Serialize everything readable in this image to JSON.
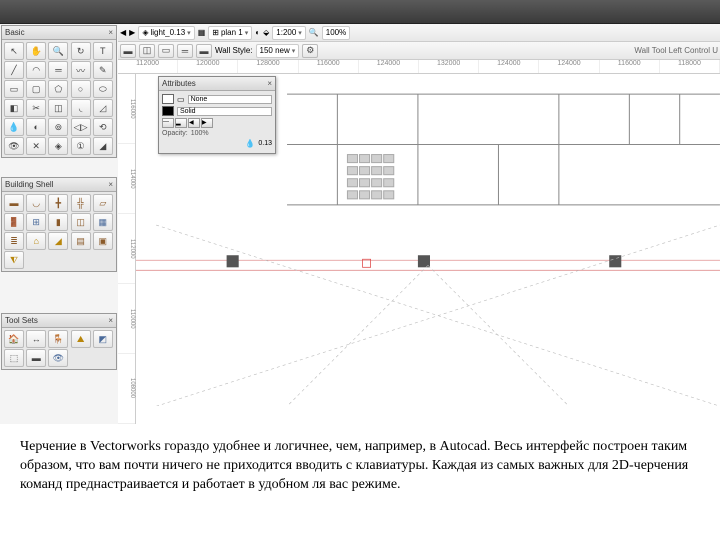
{
  "top": {
    "doc_dropdown": "light_0.13",
    "view_dropdown": "plan 1",
    "scale": "1:200",
    "zoom": "100%",
    "wall_style_label": "Wall Style:",
    "wall_style_value": "150 new",
    "wall_tool_hint": "Wall Tool Left Control U"
  },
  "ruler_x": [
    "112000",
    "120000",
    "128000",
    "116000",
    "124000",
    "132000",
    "124000",
    "124000",
    "116000",
    "118000"
  ],
  "ruler_y": [
    "116000",
    "114000",
    "112000",
    "110000",
    "108000"
  ],
  "palettes": {
    "basic": {
      "title": "Basic"
    },
    "building_shell": {
      "title": "Building Shell"
    },
    "tool_sets": {
      "title": "Tool Sets"
    }
  },
  "attributes": {
    "title": "Attributes",
    "fill_mode": "None",
    "line_mode": "Solid",
    "opacity_label": "Opacity:",
    "opacity_value": "100%",
    "hint": "0.13"
  },
  "caption": "Черчение в Vectorworks гораздо удобнее и логичнее, чем, например, в Autocad. Весь интерфейс построен таким образом, что вам почти ничего не приходится вводить с клавиатуры. Каждая из самых важных для 2D-черчения команд преднастраивается и работает в удобном ля вас режиме."
}
